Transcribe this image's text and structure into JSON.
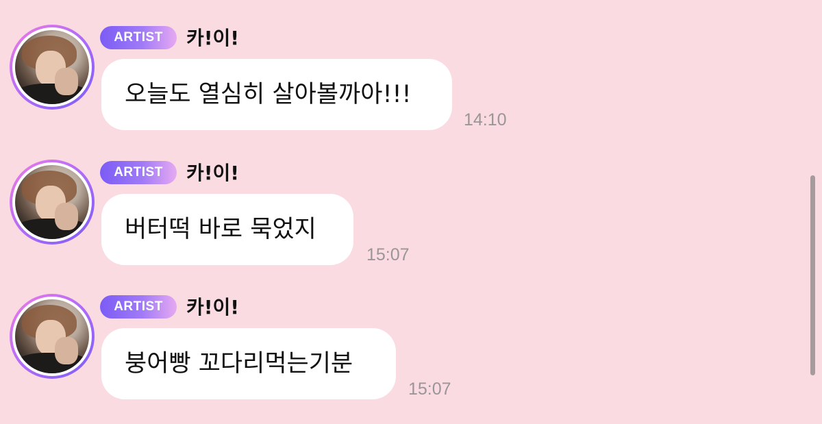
{
  "colors": {
    "background": "#fadbe1",
    "bubble": "#ffffff",
    "badge_gradient": [
      "#7b5cf5",
      "#e6a9f2"
    ],
    "avatar_ring_gradient": [
      "#f07ae8",
      "#7b5cf5"
    ],
    "timestamp": "#9a9596",
    "scrollbar": "#8f8b8c"
  },
  "messages": [
    {
      "badge": "ARTIST",
      "sender": "카!이!",
      "text": "오늘도 열심히 살아볼까아!!!",
      "time": "14:10",
      "avatar_icon": "artist-avatar"
    },
    {
      "badge": "ARTIST",
      "sender": "카!이!",
      "text": "버터떡 바로 묵었지",
      "time": "15:07",
      "avatar_icon": "artist-avatar"
    },
    {
      "badge": "ARTIST",
      "sender": "카!이!",
      "text": "붕어빵 꼬다리먹는기분",
      "time": "15:07",
      "avatar_icon": "artist-avatar"
    }
  ]
}
